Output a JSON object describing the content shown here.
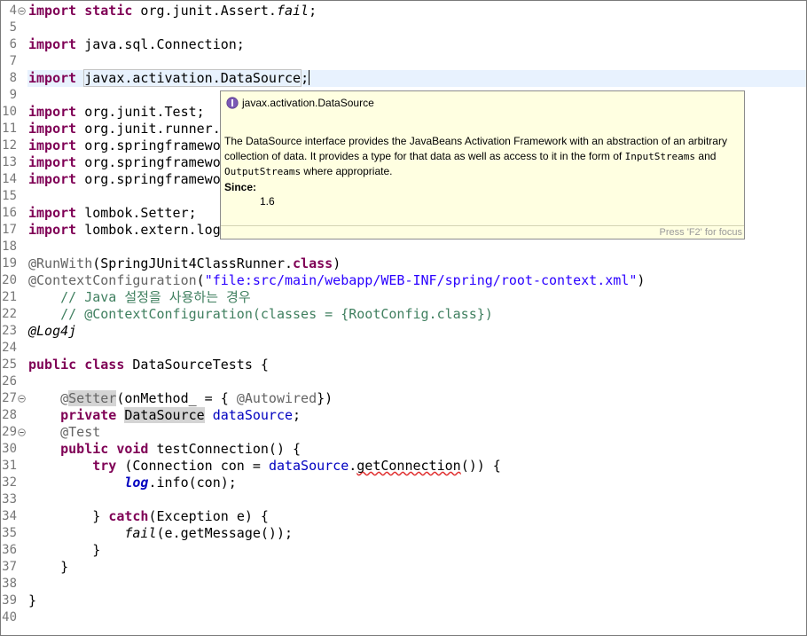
{
  "editor": {
    "line_numbers": [
      "4",
      "5",
      "6",
      "7",
      "8",
      "9",
      "10",
      "11",
      "12",
      "13",
      "14",
      "15",
      "16",
      "17",
      "18",
      "19",
      "20",
      "21",
      "22",
      "23",
      "24",
      "25",
      "26",
      "27",
      "28",
      "29",
      "30",
      "31",
      "32",
      "33",
      "34",
      "35",
      "36",
      "37",
      "38",
      "39",
      "40"
    ],
    "code": {
      "l4_kw1": "import",
      "l4_kw2": "static",
      "l4_pkg": " org.junit.Assert.",
      "l4_fn": "fail",
      "l4_end": ";",
      "l6_kw": "import",
      "l6_rest": " java.sql.Connection;",
      "l8_kw": "import",
      "l8_pkg": "javax.activation.DataSource",
      "l8_end": ";",
      "l10_kw": "import",
      "l10_rest": " org.junit.Test;",
      "l11_kw": "import",
      "l11_rest": " org.junit.runner.",
      "l12_kw": "import",
      "l12_rest": " org.springframewo",
      "l13_kw": "import",
      "l13_rest": " org.springframewo",
      "l14_kw": "import",
      "l14_rest": " org.springframewo",
      "l16_kw": "import",
      "l16_rest": " lombok.Setter;",
      "l17_kw": "import",
      "l17_rest": " lombok.extern.log",
      "l19_an": "@RunWith",
      "l19_a": "(SpringJUnit4ClassRunner.",
      "l19_kw": "class",
      "l19_b": ")",
      "l20_an": "@ContextConfiguration",
      "l20_a": "(",
      "l20_str": "\"file:src/main/webapp/WEB-INF/spring/root-context.xml\"",
      "l20_b": ")",
      "l21_cm": "// Java 설정을 사용하는 경우",
      "l22_cm": "// @ContextConfiguration(classes = {RootConfig.class})",
      "l23_an": "@Log4j",
      "l25_kw1": "public",
      "l25_kw2": "class",
      "l25_rest": " DataSourceTests {",
      "l27_at": "@",
      "l27_an": "Setter",
      "l27_rest": "(onMethod_ = { ",
      "l27_an2": "@Autowired",
      "l27_end": "})",
      "l28_kw": "private",
      "l28_type": "DataSource",
      "l28_fld": "dataSource",
      "l28_end": ";",
      "l29_an": "@Test",
      "l30_kw1": "public",
      "l30_kw2": "void",
      "l30_rest": " testConnection() {",
      "l31_kw": "try",
      "l31_a": " (Connection ",
      "l31_var": "con",
      "l31_b": " = ",
      "l31_fld": "dataSource",
      "l31_c": ".",
      "l31_err": "getConnection",
      "l31_d": "()) {",
      "l32_stat": "log",
      "l32_a": ".info(",
      "l32_var": "con",
      "l32_b": ");",
      "l34_a": "} ",
      "l34_kw": "catch",
      "l34_b": "(Exception ",
      "l34_var": "e",
      "l34_c": ") {",
      "l35_fn": "fail",
      "l35_a": "(",
      "l35_var": "e",
      "l35_b": ".getMessage());",
      "l36": "}",
      "l37": "}",
      "l39": "}"
    }
  },
  "hover": {
    "title": "javax.activation.DataSource",
    "desc_1": "The DataSource interface provides the JavaBeans Activation Framework with an abstraction of an arbitrary collection of data. It provides a type for that data as well as access to it in the form of ",
    "code_1": "InputStreams",
    "desc_2": " and ",
    "code_2": "OutputStreams",
    "desc_3": " where appropriate.",
    "since_label": "Since:",
    "since_value": "1.6",
    "footer": "Press 'F2' for focus"
  },
  "colors": {
    "keyword": "#7f0055",
    "annotation": "#646464",
    "string": "#2a00ff",
    "comment": "#3f7f5f",
    "field": "#0000c0",
    "hover_bg": "#ffffe1",
    "current_line": "#e8f2fe"
  }
}
